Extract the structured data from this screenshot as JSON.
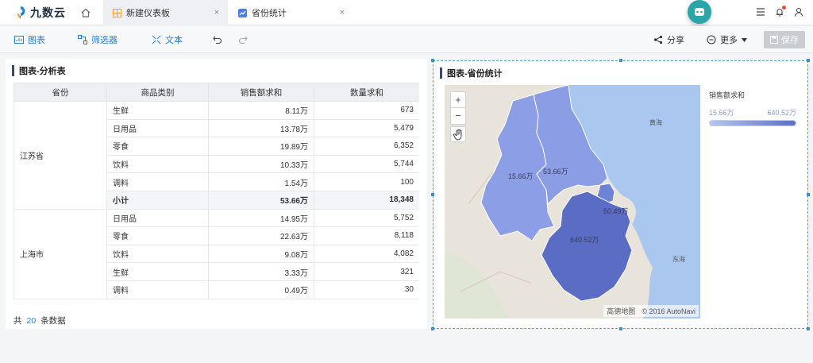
{
  "app": {
    "brand": "九数云"
  },
  "tabs": [
    {
      "label": "新建仪表板",
      "close": "×"
    },
    {
      "label": "省份统计",
      "close": "×"
    }
  ],
  "toolbar": {
    "chart": "图表",
    "filter": "筛选器",
    "text": "文本",
    "share": "分享",
    "more": "更多",
    "save": "保存"
  },
  "left_panel": {
    "title": "图表-分析表",
    "headers": [
      "省份",
      "商品类别",
      "销售额求和",
      "数量求和"
    ],
    "groups": [
      {
        "province": "江苏省",
        "rows": [
          {
            "category": "生鲜",
            "sales": "8.11万",
            "qty": "673"
          },
          {
            "category": "日用品",
            "sales": "13.78万",
            "qty": "5,479"
          },
          {
            "category": "零食",
            "sales": "19.89万",
            "qty": "6,352"
          },
          {
            "category": "饮料",
            "sales": "10.33万",
            "qty": "5,744"
          },
          {
            "category": "调料",
            "sales": "1.54万",
            "qty": "100"
          }
        ],
        "subtotal": {
          "label": "小计",
          "sales": "53.66万",
          "qty": "18,348"
        }
      },
      {
        "province": "上海市",
        "rows": [
          {
            "category": "日用品",
            "sales": "14.95万",
            "qty": "5,752"
          },
          {
            "category": "零食",
            "sales": "22.63万",
            "qty": "8,118"
          },
          {
            "category": "饮料",
            "sales": "9.08万",
            "qty": "4,082"
          },
          {
            "category": "生鲜",
            "sales": "3.33万",
            "qty": "321"
          },
          {
            "category": "调料",
            "sales": "0.49万",
            "qty": "30"
          }
        ]
      }
    ],
    "footer": {
      "prefix": "共",
      "count": "20",
      "suffix": "条数据"
    }
  },
  "right_panel": {
    "title": "图表-省份统计",
    "legend": {
      "title": "销售额求和",
      "min": "15.66万",
      "max": "640.52万"
    },
    "region_labels": [
      "15.66万",
      "53.66万",
      "50.49万",
      "640.52万"
    ],
    "region_colors": [
      "#8c9fe6",
      "#8b9ee5",
      "#6e82d6",
      "#5a6cc4"
    ],
    "sea_labels": [
      "黄海",
      "东海"
    ],
    "zoom_in": "+",
    "zoom_out": "−",
    "attribution": {
      "brand": "高德地图",
      "copyright": "© 2016 AutoNavi"
    }
  },
  "colors": {
    "accent": "#2a7ec8",
    "teal": "#2aa6a8",
    "sea": "#a9c7ef"
  }
}
